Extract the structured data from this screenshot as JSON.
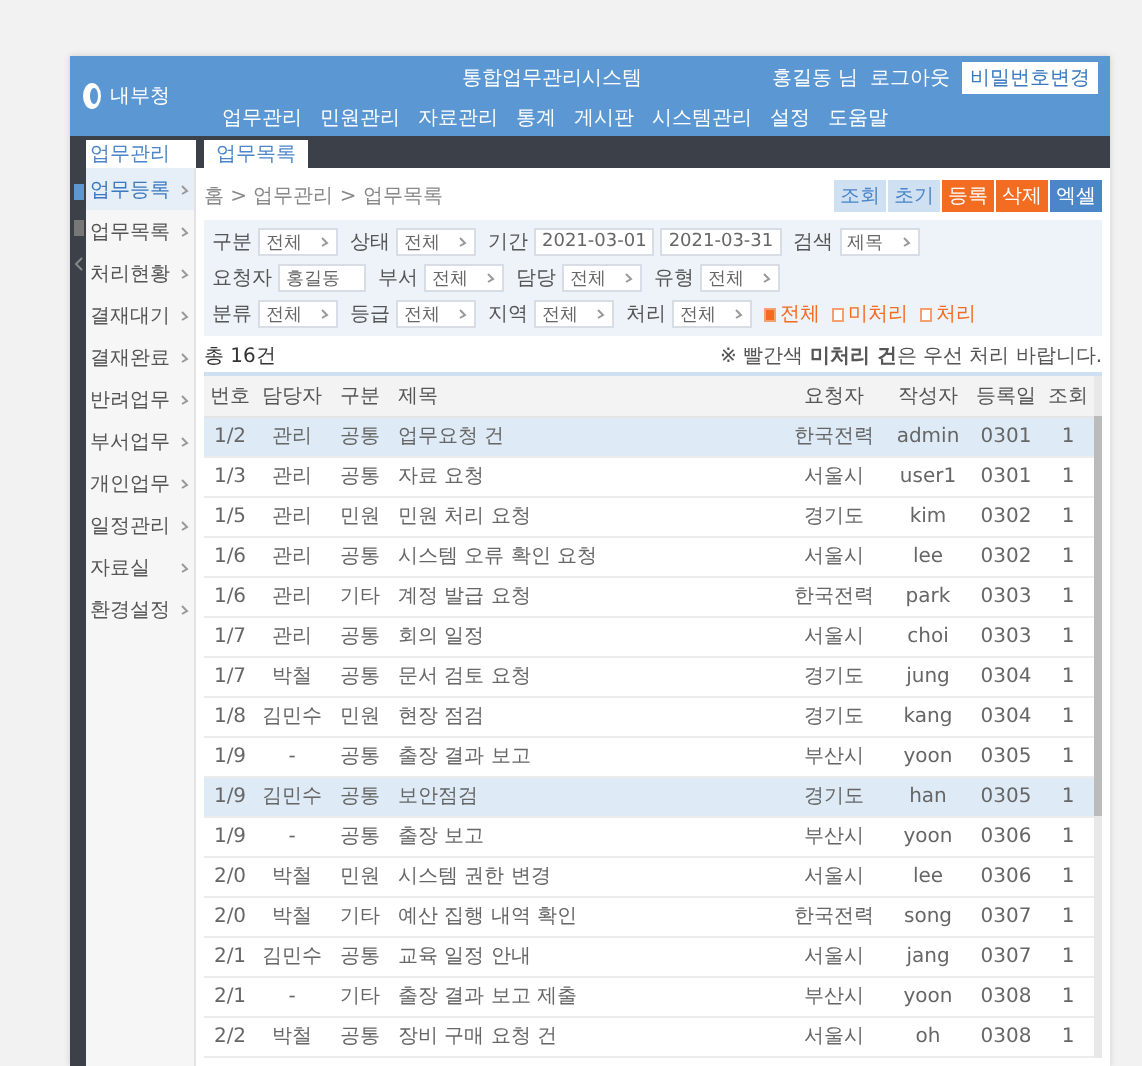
{
  "header": {
    "logo": "내부청",
    "title": "통합업무관리시스템",
    "user": "홍길동 님",
    "logout": "로그아웃",
    "button": "비밀번호변경"
  },
  "nav": [
    "업무관리",
    "민원관리",
    "자료관리",
    "통계",
    "게시판",
    "시스템관리",
    "설정",
    "도움말"
  ],
  "sidebar": {
    "title": "업무관리",
    "items": [
      {
        "label": "업무등록",
        "selected": true
      },
      {
        "label": "업무목록",
        "selected": false
      },
      {
        "label": "처리현황",
        "selected": false
      },
      {
        "label": "결재대기",
        "selected": false
      },
      {
        "label": "결재완료",
        "selected": false
      },
      {
        "label": "반려업무",
        "selected": false
      },
      {
        "label": "부서업무",
        "selected": false
      },
      {
        "label": "개인업무",
        "selected": false
      },
      {
        "label": "일정관리",
        "selected": false
      },
      {
        "label": "자료실",
        "selected": false
      },
      {
        "label": "환경설정",
        "selected": false
      }
    ]
  },
  "tab": "업무목록",
  "breadcrumb": "홈 > 업무관리 > 업무목록",
  "buttons": [
    {
      "label": "조회",
      "kind": "light"
    },
    {
      "label": "초기",
      "kind": "light"
    },
    {
      "label": "등록",
      "kind": "accent"
    },
    {
      "label": "삭제",
      "kind": "accent"
    },
    {
      "label": "엑셀",
      "kind": "primary"
    }
  ],
  "filters": [
    [
      {
        "label": "구분",
        "kind": "select",
        "value": "전체"
      },
      {
        "label": "상태",
        "kind": "select",
        "value": "전체"
      },
      {
        "label": "기간",
        "kind": "range",
        "value": "2021-03-01",
        "value2": "2021-03-31"
      },
      {
        "label": "검색",
        "kind": "select",
        "value": "제목"
      }
    ],
    [
      {
        "label": "요청자",
        "kind": "input",
        "value": "홍길동"
      },
      {
        "label": "부서",
        "kind": "select",
        "value": "전체"
      },
      {
        "label": "담당",
        "kind": "select",
        "value": "전체"
      },
      {
        "label": "유형",
        "kind": "select",
        "value": "전체"
      }
    ],
    [
      {
        "label": "분류",
        "kind": "select",
        "value": "전체"
      },
      {
        "label": "등급",
        "kind": "select",
        "value": "전체"
      },
      {
        "label": "지역",
        "kind": "select",
        "value": "전체"
      },
      {
        "label": "처리",
        "kind": "select",
        "value": "전체"
      }
    ]
  ],
  "status_options": [
    {
      "label": "전체",
      "selected": true
    },
    {
      "label": "미처리",
      "selected": false
    },
    {
      "label": "처리",
      "selected": false
    }
  ],
  "list_title": "총 16건",
  "note": "※ 빨간색 **미처리 건**은 우선 처리 바랍니다.",
  "table": {
    "columns": [
      "번호",
      "담당자",
      "구분",
      "제목",
      "요청자",
      "작성자",
      "등록일",
      "조회"
    ],
    "rows": [
      {
        "cells": [
          "1/2",
          "관리",
          "공통",
          "업무요청 건",
          "한국전력",
          "admin",
          "0301",
          "1"
        ],
        "selected": true
      },
      {
        "cells": [
          "1/3",
          "관리",
          "공통",
          "자료 요청",
          "서울시",
          "user1",
          "0301",
          "1"
        ],
        "selected": false
      },
      {
        "cells": [
          "1/5",
          "관리",
          "민원",
          "민원 처리 요청",
          "경기도",
          "kim",
          "0302",
          "1"
        ],
        "selected": false
      },
      {
        "cells": [
          "1/6",
          "관리",
          "공통",
          "시스템 오류 확인 요청",
          "서울시",
          "lee",
          "0302",
          "1"
        ],
        "selected": false
      },
      {
        "cells": [
          "1/6",
          "관리",
          "기타",
          "계정 발급 요청",
          "한국전력",
          "park",
          "0303",
          "1"
        ],
        "selected": false
      },
      {
        "cells": [
          "1/7",
          "관리",
          "공통",
          "회의 일정",
          "서울시",
          "choi",
          "0303",
          "1"
        ],
        "selected": false
      },
      {
        "cells": [
          "1/7",
          "박철",
          "공통",
          "문서 검토 요청",
          "경기도",
          "jung",
          "0304",
          "1"
        ],
        "selected": false
      },
      {
        "cells": [
          "1/8",
          "김민수",
          "민원",
          "현장 점검",
          "경기도",
          "kang",
          "0304",
          "1"
        ],
        "selected": false
      },
      {
        "cells": [
          "1/9",
          "-",
          "공통",
          "출장 결과 보고",
          "부산시",
          "yoon",
          "0305",
          "1"
        ],
        "selected": false
      },
      {
        "cells": [
          "1/9",
          "김민수",
          "공통",
          "보안점검",
          "경기도",
          "han",
          "0305",
          "1"
        ],
        "selected": true
      },
      {
        "cells": [
          "1/9",
          "-",
          "공통",
          "출장 보고",
          "부산시",
          "yoon",
          "0306",
          "1"
        ],
        "selected": false
      },
      {
        "cells": [
          "2/0",
          "박철",
          "민원",
          "시스템 권한 변경",
          "서울시",
          "lee",
          "0306",
          "1"
        ],
        "selected": false
      },
      {
        "cells": [
          "2/0",
          "박철",
          "기타",
          "예산 집행 내역 확인",
          "한국전력",
          "song",
          "0307",
          "1"
        ],
        "selected": false
      },
      {
        "cells": [
          "2/1",
          "김민수",
          "공통",
          "교육 일정 안내",
          "서울시",
          "jang",
          "0307",
          "1"
        ],
        "selected": false
      },
      {
        "cells": [
          "2/1",
          "-",
          "기타",
          "출장 결과 보고 제출",
          "부산시",
          "yoon",
          "0308",
          "1"
        ],
        "selected": false
      },
      {
        "cells": [
          "2/2",
          "박철",
          "공통",
          "장비 구매 요청 건",
          "서울시",
          "oh",
          "0308",
          "1"
        ],
        "selected": false
      }
    ]
  }
}
